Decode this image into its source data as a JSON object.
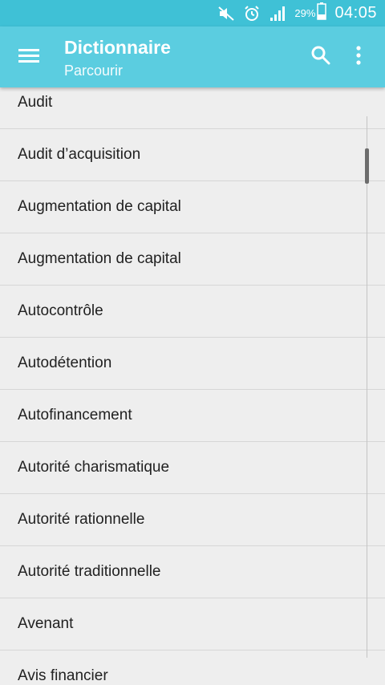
{
  "status_bar": {
    "icons": [
      "mute-icon",
      "alarm-icon",
      "signal-icon",
      "battery-icon"
    ],
    "battery_percent": "29%",
    "time": "04:05"
  },
  "app_bar": {
    "title": "Dictionnaire",
    "subtitle": "Parcourir",
    "color": "#5bcde0",
    "icons": [
      "menu-icon",
      "search-icon",
      "more-vert-icon"
    ]
  },
  "list": {
    "items": [
      "Audit",
      "Audit d’acquisition",
      "Augmentation de capital",
      "Augmentation de capital",
      "Autocontrôle",
      "Autodétention",
      "Autofinancement",
      "Autorité charismatique",
      "Autorité rationnelle",
      "Autorité traditionnelle",
      "Avenant",
      "Avis financier"
    ]
  }
}
